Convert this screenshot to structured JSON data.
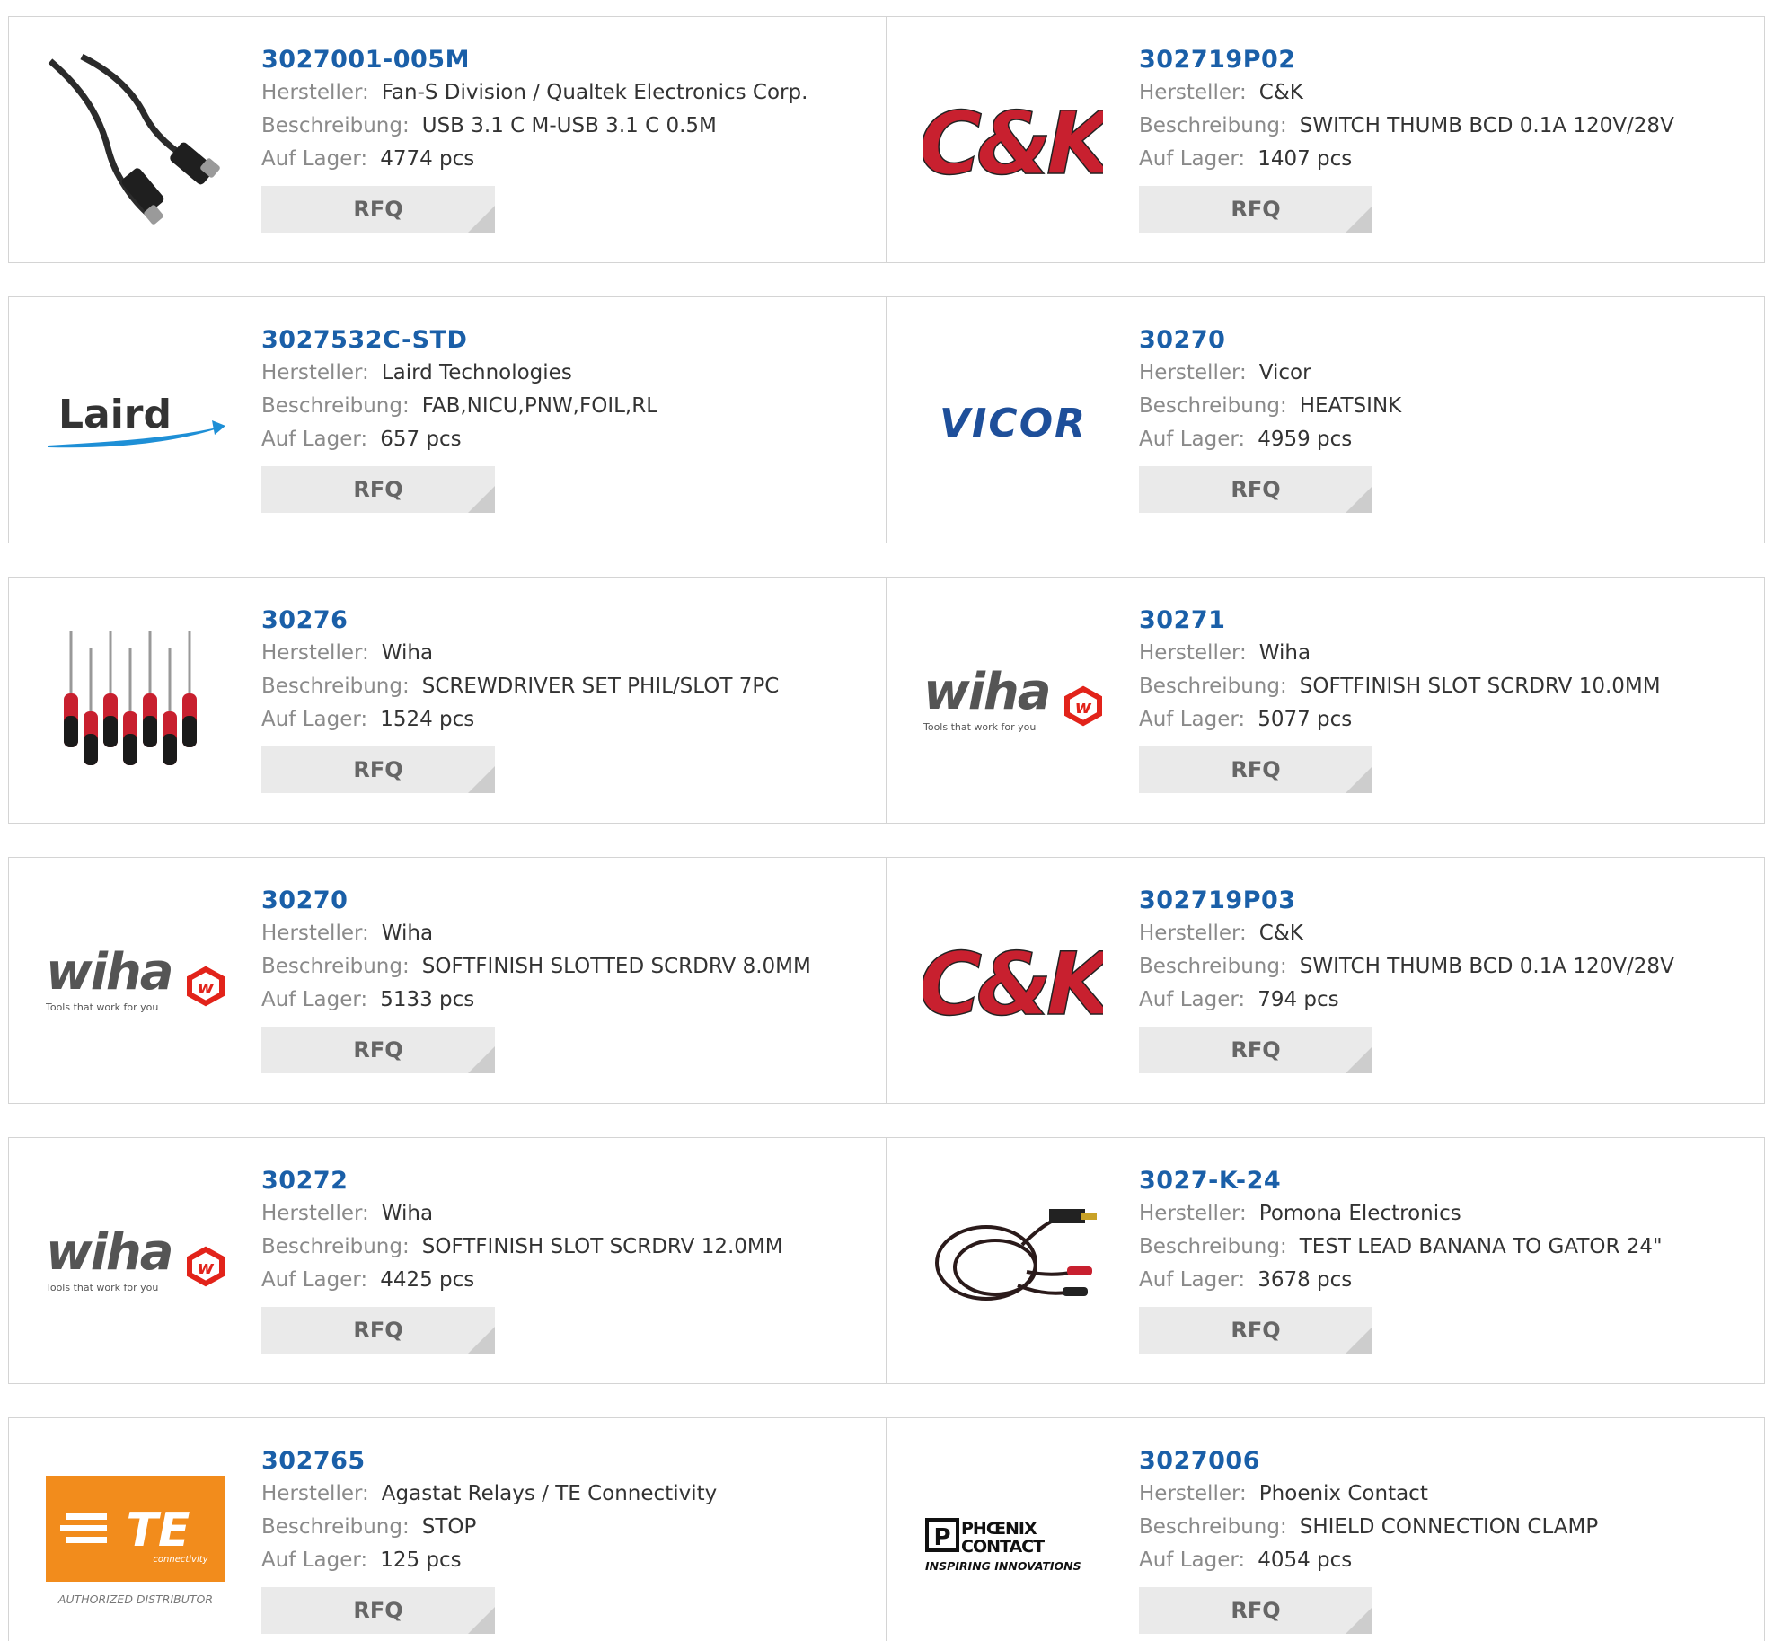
{
  "labels": {
    "manufacturer": "Hersteller:",
    "description": "Beschreibung:",
    "stock": "Auf Lager:",
    "rfq": "RFQ"
  },
  "products": [
    {
      "part": "3027001-005M",
      "manufacturer": "Fan-S Division / Qualtek Electronics Corp.",
      "description": "USB 3.1 C M-USB 3.1 C 0.5M",
      "stock": "4774 pcs",
      "image": "usb-c-cable-photo"
    },
    {
      "part": "302719P02",
      "manufacturer": "C&K",
      "description": "SWITCH THUMB BCD 0.1A 120V/28V",
      "stock": "1407 pcs",
      "image": "ck-logo"
    },
    {
      "part": "3027532C-STD",
      "manufacturer": "Laird Technologies",
      "description": "FAB,NICU,PNW,FOIL,RL",
      "stock": "657 pcs",
      "image": "laird-logo"
    },
    {
      "part": "30270",
      "manufacturer": "Vicor",
      "description": "HEATSINK",
      "stock": "4959 pcs",
      "image": "vicor-logo"
    },
    {
      "part": "30276",
      "manufacturer": "Wiha",
      "description": "SCREWDRIVER SET PHIL/SLOT 7PC",
      "stock": "1524 pcs",
      "image": "screwdriver-set-photo"
    },
    {
      "part": "30271",
      "manufacturer": "Wiha",
      "description": "SOFTFINISH SLOT SCRDRV 10.0MM",
      "stock": "5077 pcs",
      "image": "wiha-logo"
    },
    {
      "part": "30270",
      "manufacturer": "Wiha",
      "description": "SOFTFINISH SLOTTED SCRDRV 8.0MM",
      "stock": "5133 pcs",
      "image": "wiha-logo"
    },
    {
      "part": "302719P03",
      "manufacturer": "C&K",
      "description": "SWITCH THUMB BCD 0.1A 120V/28V",
      "stock": "794 pcs",
      "image": "ck-logo"
    },
    {
      "part": "30272",
      "manufacturer": "Wiha",
      "description": "SOFTFINISH SLOT SCRDRV 12.0MM",
      "stock": "4425 pcs",
      "image": "wiha-logo"
    },
    {
      "part": "3027-K-24",
      "manufacturer": "Pomona Electronics",
      "description": "TEST LEAD BANANA TO GATOR 24\"",
      "stock": "3678 pcs",
      "image": "test-lead-photo"
    },
    {
      "part": "302765",
      "manufacturer": "Agastat Relays / TE Connectivity",
      "description": "STOP",
      "stock": "125 pcs",
      "image": "te-connectivity-logo"
    },
    {
      "part": "3027006",
      "manufacturer": "Phoenix Contact",
      "description": "SHIELD CONNECTION CLAMP",
      "stock": "4054 pcs",
      "image": "phoenix-contact-logo"
    }
  ],
  "logos": {
    "ck": "C&K",
    "laird": "Laird",
    "vicor": "VICOR",
    "wiha": "wiha",
    "wiha_tagline": "Tools that work for you",
    "te": "TE",
    "te_sub": "connectivity",
    "te_caption": "AUTHORIZED DISTRIBUTOR",
    "phoenix_1": "PHŒNIX",
    "phoenix_2": "CONTACT",
    "phoenix_tagline": "INSPIRING INNOVATIONS"
  },
  "colors": {
    "part_link": "#1a5fa8",
    "label": "#8a8a8a",
    "value": "#333333",
    "button_bg": "#eaeaea",
    "ck_red": "#c8202f",
    "vicor_blue": "#1e4f9a",
    "wiha_red": "#e2231a",
    "te_orange": "#f28c1c"
  }
}
